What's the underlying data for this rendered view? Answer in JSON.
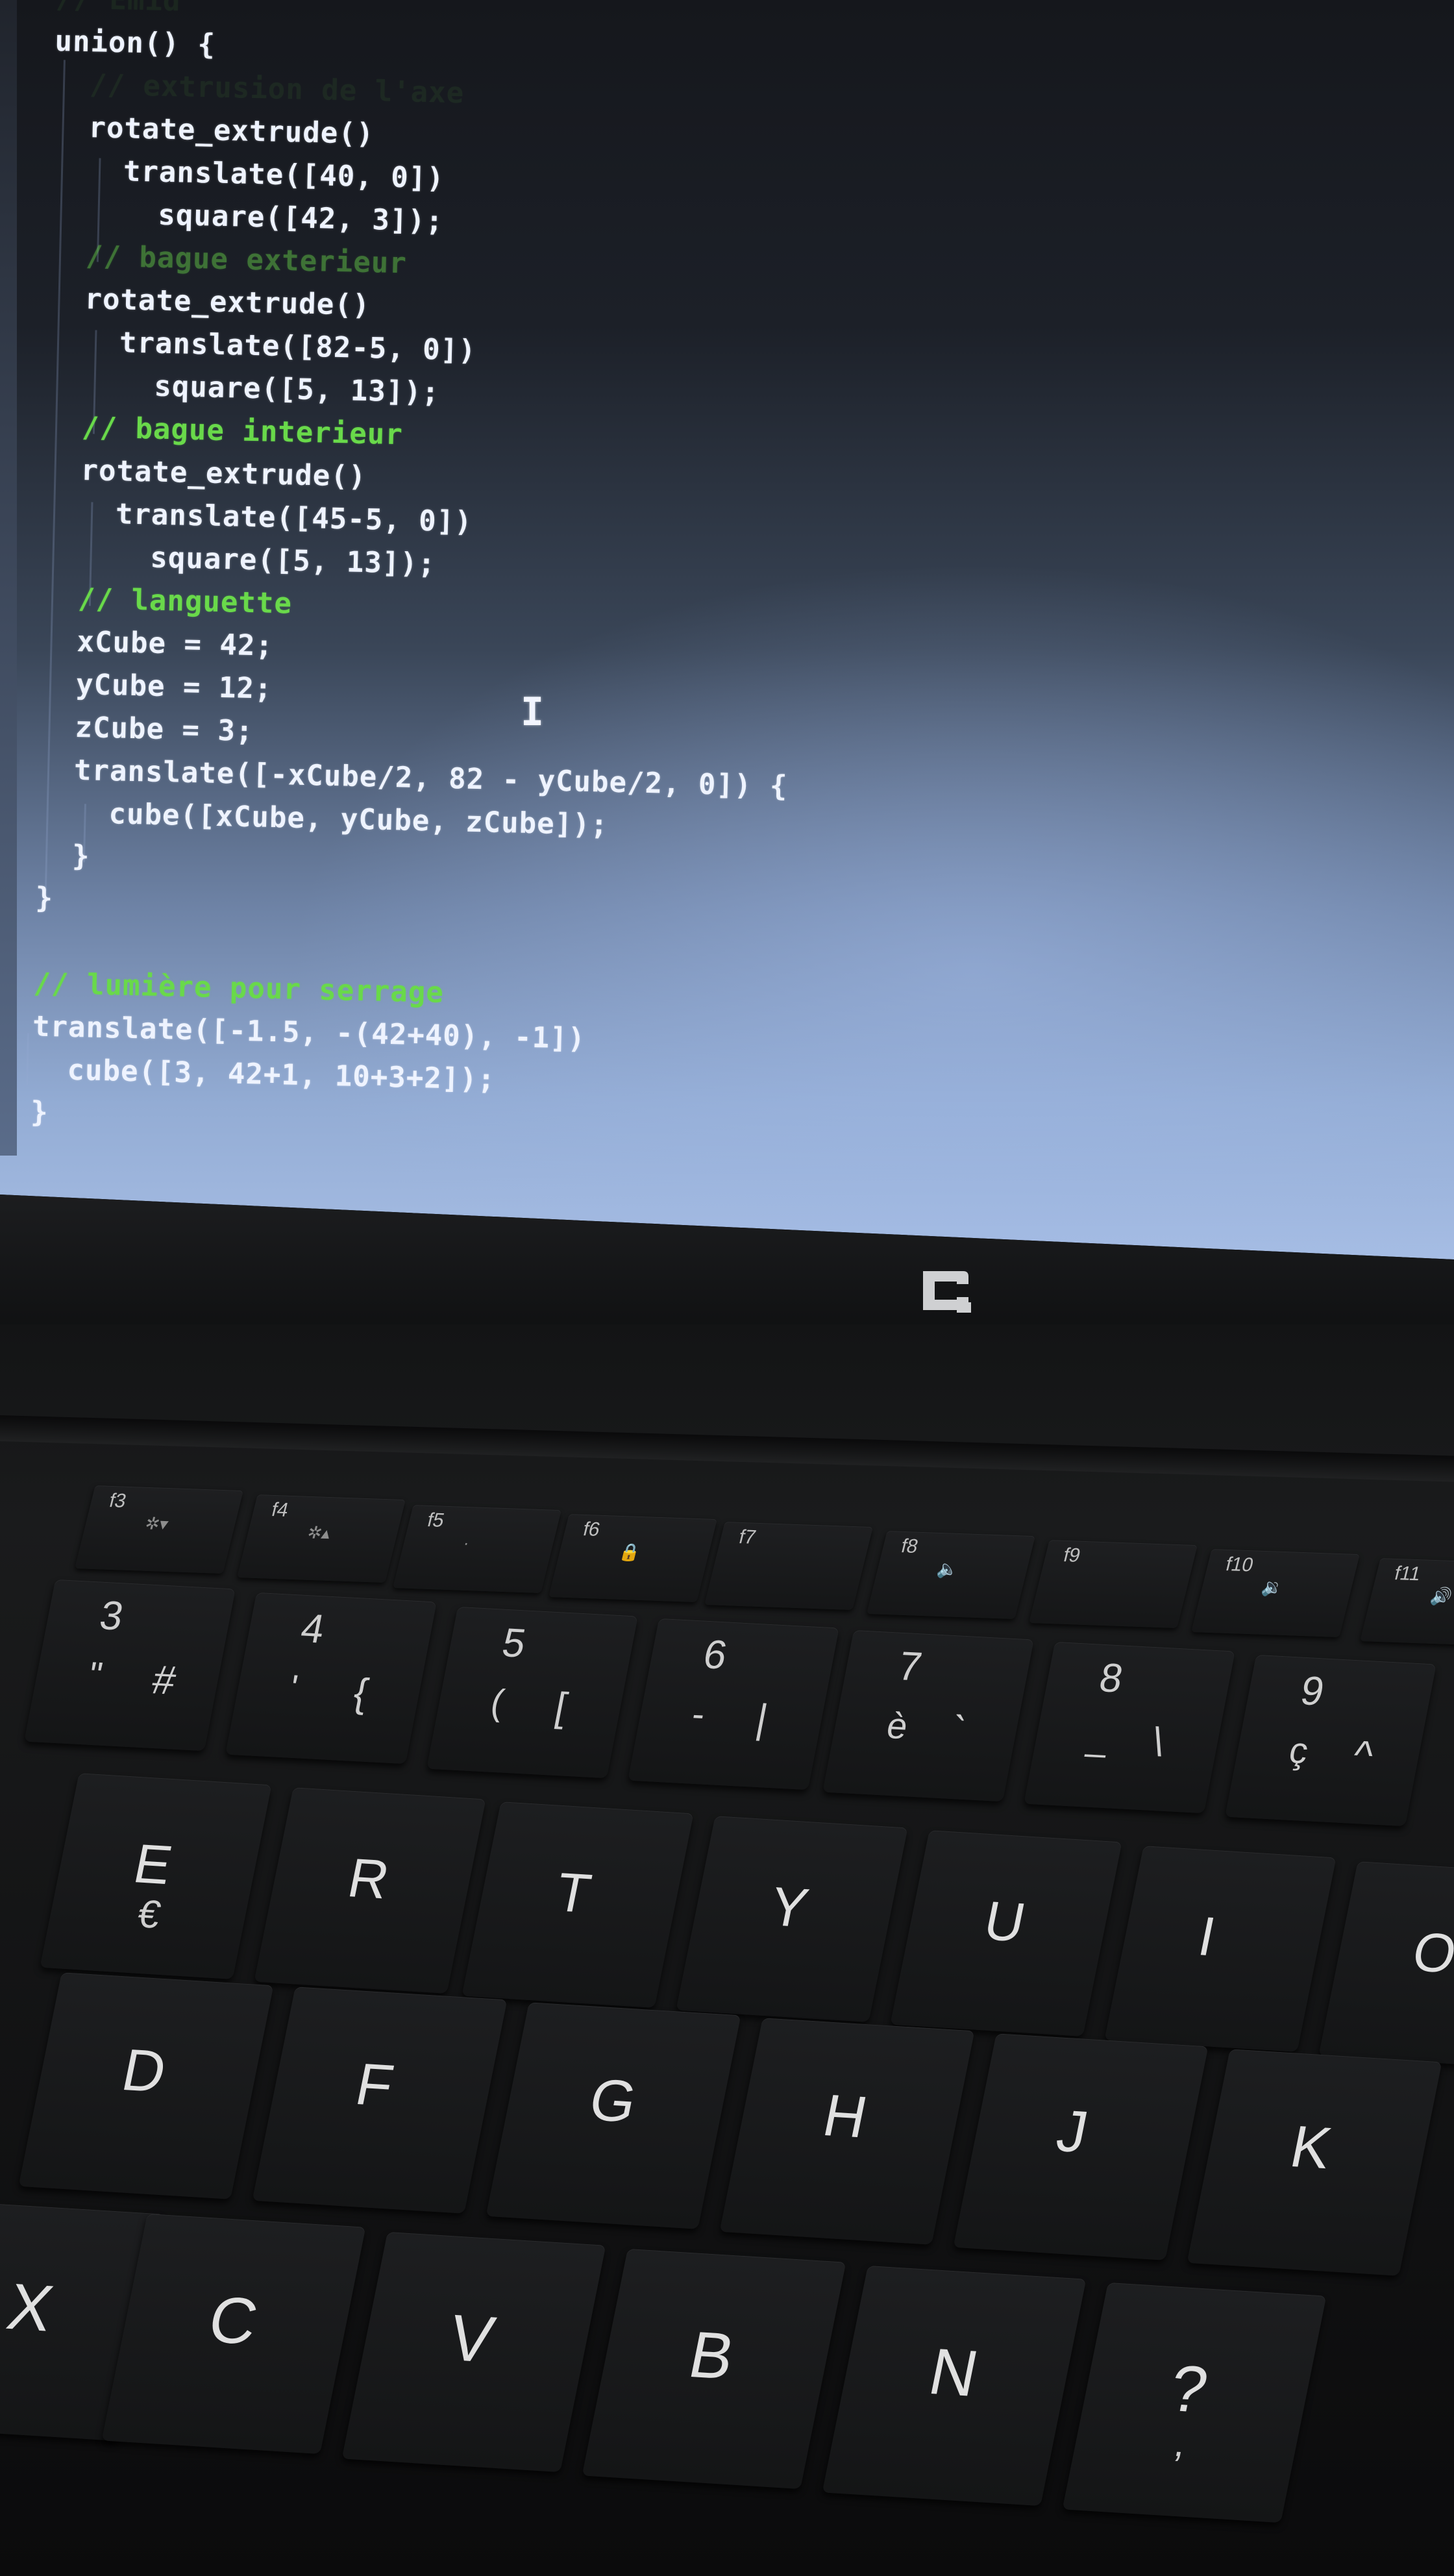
{
  "editor": {
    "lines": [
      {
        "text": "// Emid",
        "kind": "comment",
        "tone": "faint"
      },
      {
        "text": "union() {",
        "kind": "code"
      },
      {
        "text": "  // extrusion de l'axe",
        "kind": "comment",
        "tone": "faint"
      },
      {
        "text": "  rotate_extrude()",
        "kind": "code"
      },
      {
        "text": "    translate([40, 0])",
        "kind": "code"
      },
      {
        "text": "      square([42, 3]);",
        "kind": "code"
      },
      {
        "text": "  // bague exterieur",
        "kind": "comment",
        "tone": "dim"
      },
      {
        "text": "  rotate_extrude()",
        "kind": "code"
      },
      {
        "text": "    translate([82-5, 0])",
        "kind": "code"
      },
      {
        "text": "      square([5, 13]);",
        "kind": "code"
      },
      {
        "text": "  // bague interieur",
        "kind": "comment"
      },
      {
        "text": "  rotate_extrude()",
        "kind": "code"
      },
      {
        "text": "    translate([45-5, 0])",
        "kind": "code"
      },
      {
        "text": "      square([5, 13]);",
        "kind": "code"
      },
      {
        "text": "  // languette",
        "kind": "comment"
      },
      {
        "text": "  xCube = 42;",
        "kind": "code"
      },
      {
        "text": "  yCube = 12;",
        "kind": "code"
      },
      {
        "text": "  zCube = 3;",
        "kind": "code"
      },
      {
        "text": "  translate([-xCube/2, 82 - yCube/2, 0]) {",
        "kind": "code"
      },
      {
        "text": "    cube([xCube, yCube, zCube]);",
        "kind": "code"
      },
      {
        "text": "  }",
        "kind": "code"
      },
      {
        "text": "}",
        "kind": "code"
      },
      {
        "text": "",
        "kind": "code"
      },
      {
        "text": "// lumière pour serrage",
        "kind": "comment"
      },
      {
        "text": "translate([-1.5, -(42+40), -1])",
        "kind": "code"
      },
      {
        "text": "  cube([3, 42+1, 10+3+2]);",
        "kind": "code"
      },
      {
        "text": "}",
        "kind": "code"
      }
    ],
    "colors": {
      "code": "#eef3ff",
      "comment": "#69d94a"
    },
    "cursor_icon": "text-cursor-ibeam-icon"
  },
  "laptop": {
    "brand_logo_icon": "compaq-logo-icon"
  },
  "keyboard": {
    "function_keys": [
      {
        "label": "f3",
        "symbol": "✲▾"
      },
      {
        "label": "f4",
        "symbol": "✲▴"
      },
      {
        "label": "f5",
        "symbol": "·"
      },
      {
        "label": "f6",
        "symbol": "🔒"
      },
      {
        "label": "f7",
        "symbol": ""
      },
      {
        "label": "f8",
        "symbol": "🔈"
      },
      {
        "label": "f9",
        "symbol": ""
      },
      {
        "label": "f10",
        "symbol": "🔉"
      },
      {
        "label": "f11",
        "symbol": "🔊"
      }
    ],
    "number_row": [
      {
        "id": "3",
        "top": "3",
        "bottom_left": "\"",
        "bottom_right": "#"
      },
      {
        "id": "4",
        "top": "4",
        "bottom_left": "'",
        "bottom_right": "{"
      },
      {
        "id": "5",
        "top": "5",
        "bottom_left": "(",
        "bottom_right": "["
      },
      {
        "id": "6",
        "top": "6",
        "bottom_left": "-",
        "bottom_right": "|"
      },
      {
        "id": "7",
        "top": "7",
        "bottom_left": "è",
        "bottom_right": "`"
      },
      {
        "id": "8",
        "top": "8",
        "bottom_left": "_",
        "bottom_right": "\\"
      },
      {
        "id": "9",
        "top": "9",
        "bottom_left": "ç",
        "bottom_right": "^"
      }
    ],
    "row_top": [
      {
        "id": "e",
        "main": "E",
        "alt": "€"
      },
      {
        "id": "r",
        "main": "R",
        "alt": ""
      },
      {
        "id": "t",
        "main": "T",
        "alt": ""
      },
      {
        "id": "y",
        "main": "Y",
        "alt": ""
      },
      {
        "id": "u",
        "main": "U",
        "alt": ""
      },
      {
        "id": "i",
        "main": "I",
        "alt": ""
      },
      {
        "id": "o",
        "main": "O",
        "alt": ""
      }
    ],
    "row_home": [
      {
        "id": "d",
        "main": "D"
      },
      {
        "id": "f",
        "main": "F"
      },
      {
        "id": "g",
        "main": "G"
      },
      {
        "id": "h",
        "main": "H"
      },
      {
        "id": "j",
        "main": "J"
      },
      {
        "id": "k",
        "main": "K"
      }
    ],
    "row_bottom": [
      {
        "id": "x",
        "main": "X",
        "alt": ""
      },
      {
        "id": "c",
        "main": "C",
        "alt": ""
      },
      {
        "id": "v",
        "main": "V",
        "alt": ""
      },
      {
        "id": "b",
        "main": "B",
        "alt": ""
      },
      {
        "id": "n",
        "main": "N",
        "alt": ""
      },
      {
        "id": "comma",
        "main": "?",
        "alt": ","
      }
    ]
  }
}
